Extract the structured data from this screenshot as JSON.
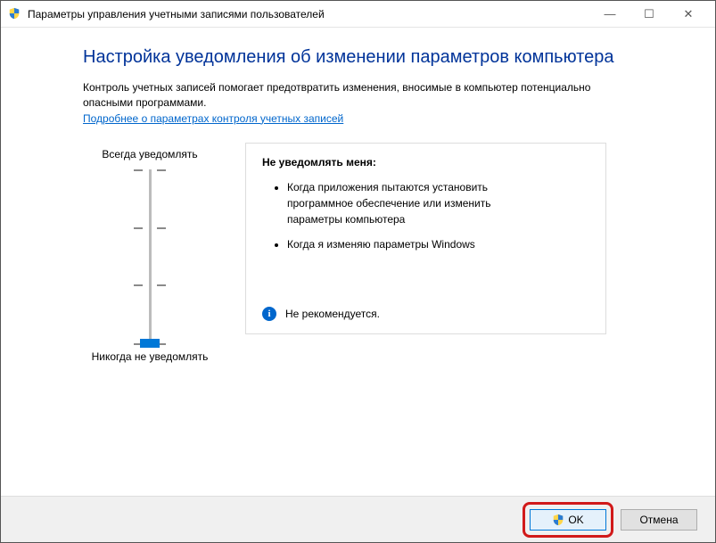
{
  "titlebar": {
    "title": "Параметры управления учетными записями пользователей"
  },
  "main": {
    "heading": "Настройка уведомления об изменении параметров компьютера",
    "description": "Контроль учетных записей помогает предотвратить изменения, вносимые в компьютер потенциально опасными программами.",
    "link": "Подробнее о параметрах контроля учетных записей"
  },
  "slider": {
    "top_label": "Всегда уведомлять",
    "bottom_label": "Никогда не уведомлять",
    "levels": 4,
    "current_level": 0
  },
  "panel": {
    "title": "Не уведомлять меня:",
    "items": [
      "Когда приложения пытаются установить программное обеспечение или изменить параметры компьютера",
      "Когда я изменяю параметры Windows"
    ],
    "footer": "Не рекомендуется."
  },
  "buttons": {
    "ok": "OK",
    "cancel": "Отмена"
  },
  "glyphs": {
    "minimize": "—",
    "maximize": "☐",
    "close": "✕",
    "info": "i"
  }
}
